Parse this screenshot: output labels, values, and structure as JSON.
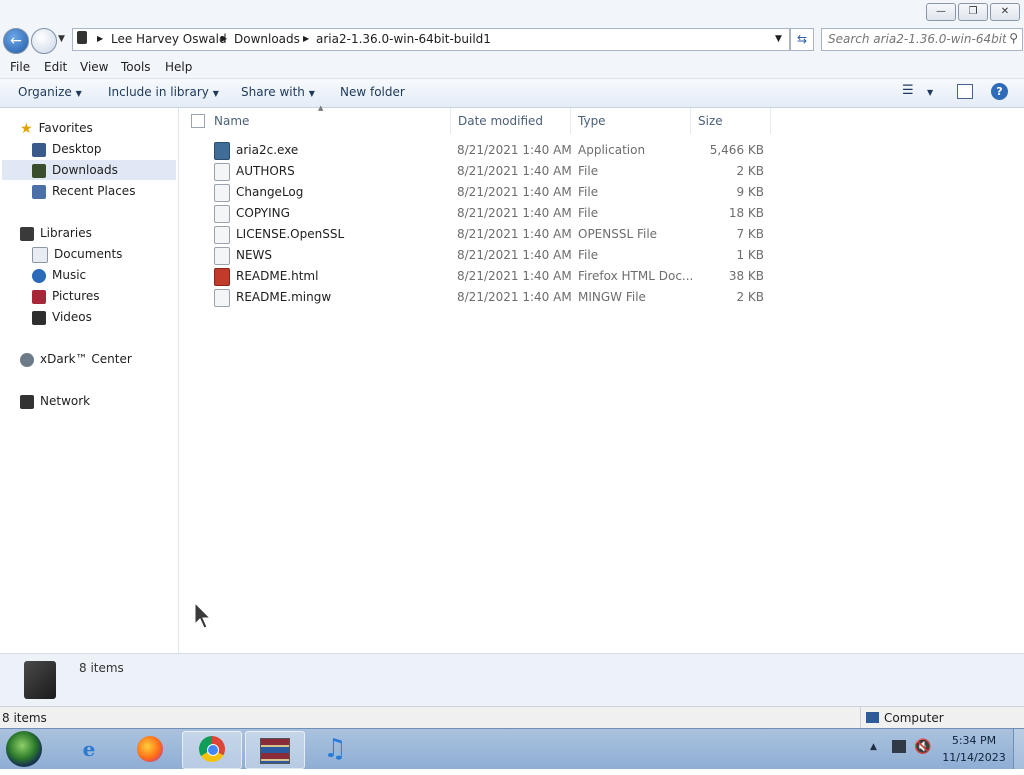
{
  "window": {
    "minimize_glyph": "—",
    "maximize_glyph": "❐",
    "close_glyph": "✕"
  },
  "address": {
    "back_icon": "back-arrow-icon",
    "forward_icon": "forward-arrow-icon",
    "breadcrumb": [
      "Lee Harvey Oswald",
      "Downloads",
      "aria2-1.36.0-win-64bit-build1"
    ],
    "search_placeholder": "Search aria2-1.36.0-win-64bit-..."
  },
  "menubar": [
    "File",
    "Edit",
    "View",
    "Tools",
    "Help"
  ],
  "toolbar": {
    "organize": "Organize",
    "include_in_library": "Include in library",
    "share_with": "Share with",
    "new_folder": "New folder"
  },
  "nav": {
    "favorites_label": "Favorites",
    "favorites": [
      "Desktop",
      "Downloads",
      "Recent Places"
    ],
    "libraries_label": "Libraries",
    "libraries": [
      "Documents",
      "Music",
      "Pictures",
      "Videos"
    ],
    "xdark_label": "xDark™ Center",
    "network_label": "Network"
  },
  "columns": {
    "name": "Name",
    "date": "Date modified",
    "type": "Type",
    "size": "Size"
  },
  "files": [
    {
      "name": "aria2c.exe",
      "date": "8/21/2021 1:40 AM",
      "type": "Application",
      "size": "5,466 KB",
      "icon": "application-icon"
    },
    {
      "name": "AUTHORS",
      "date": "8/21/2021 1:40 AM",
      "type": "File",
      "size": "2 KB",
      "icon": "file-icon"
    },
    {
      "name": "ChangeLog",
      "date": "8/21/2021 1:40 AM",
      "type": "File",
      "size": "9 KB",
      "icon": "file-icon"
    },
    {
      "name": "COPYING",
      "date": "8/21/2021 1:40 AM",
      "type": "File",
      "size": "18 KB",
      "icon": "file-icon"
    },
    {
      "name": "LICENSE.OpenSSL",
      "date": "8/21/2021 1:40 AM",
      "type": "OPENSSL File",
      "size": "7 KB",
      "icon": "file-icon"
    },
    {
      "name": "NEWS",
      "date": "8/21/2021 1:40 AM",
      "type": "File",
      "size": "1 KB",
      "icon": "file-icon"
    },
    {
      "name": "README.html",
      "date": "8/21/2021 1:40 AM",
      "type": "Firefox HTML Doc...",
      "size": "38 KB",
      "icon": "firefox-html-icon"
    },
    {
      "name": "README.mingw",
      "date": "8/21/2021 1:40 AM",
      "type": "MINGW File",
      "size": "2 KB",
      "icon": "file-icon"
    }
  ],
  "details": {
    "count": "8 items"
  },
  "status": {
    "items": "8 items",
    "computer": "Computer"
  },
  "taskbar": {
    "apps": [
      "start-orb-icon",
      "internet-explorer-icon",
      "firefox-icon",
      "chrome-icon",
      "winrar-icon",
      "music-icon"
    ],
    "time": "5:34 PM",
    "date": "11/14/2023"
  },
  "colors": {
    "selection": "#dfe8f4",
    "toolbar_text": "#1e395b",
    "meta_text": "#6d6d6d"
  }
}
